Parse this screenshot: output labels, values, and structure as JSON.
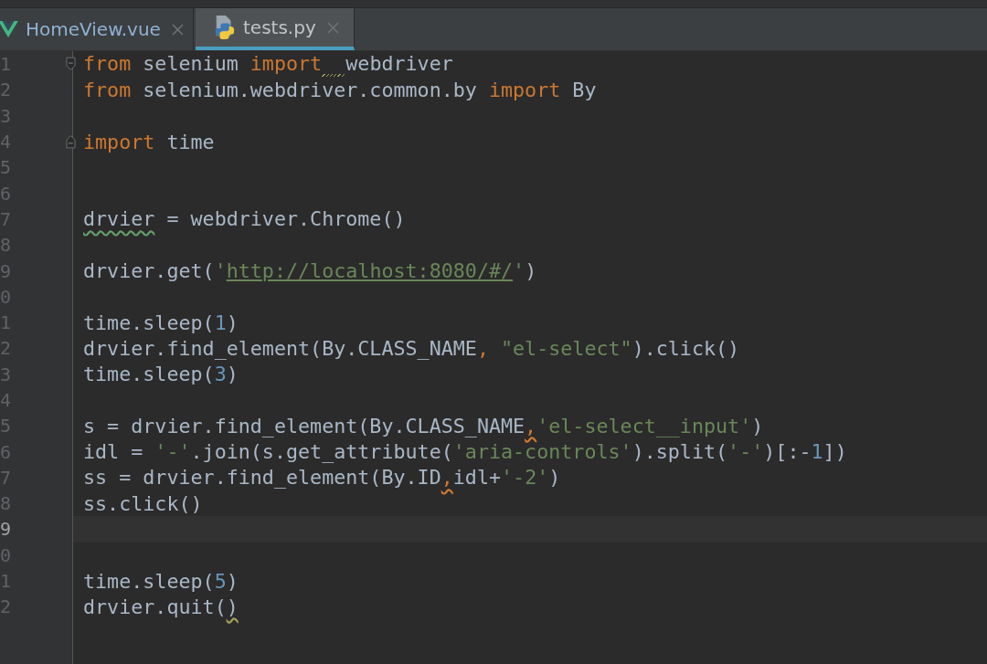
{
  "tabs": [
    {
      "label": "HomeView.vue",
      "selected": false
    },
    {
      "label": "tests.py",
      "selected": true
    }
  ],
  "editor": {
    "lines": [
      {
        "number": "1",
        "current": false,
        "fold_start": true,
        "tokens": [
          {
            "kind": "keyword",
            "text": "from"
          },
          {
            "kind": "plain",
            "text": " selenium "
          },
          {
            "kind": "keyword",
            "text": "import"
          },
          {
            "kind": "gap",
            "warning": true
          },
          {
            "kind": "plain",
            "text": "webdriver"
          }
        ]
      },
      {
        "number": "2",
        "current": false,
        "tokens": [
          {
            "kind": "keyword",
            "text": "from"
          },
          {
            "kind": "plain",
            "text": " selenium.webdriver.common.by "
          },
          {
            "kind": "keyword",
            "text": "import"
          },
          {
            "kind": "plain",
            "text": " By"
          }
        ]
      },
      {
        "number": "3",
        "current": false
      },
      {
        "number": "4",
        "current": false,
        "fold_end": true,
        "tokens": [
          {
            "kind": "keyword",
            "text": "import"
          },
          {
            "kind": "plain",
            "text": " time"
          }
        ]
      },
      {
        "number": "5",
        "current": false
      },
      {
        "number": "6",
        "current": false
      },
      {
        "number": "7",
        "current": false,
        "tokens": [
          {
            "kind": "plain",
            "text": "drvier",
            "typo": true
          },
          {
            "kind": "plain",
            "text": " = webdriver.Chrome()"
          }
        ]
      },
      {
        "number": "8",
        "current": false
      },
      {
        "number": "9",
        "current": false,
        "tokens": [
          {
            "kind": "plain",
            "text": "drvier.get("
          },
          {
            "kind": "string",
            "text": "'"
          },
          {
            "kind": "url",
            "text": "http://localhost:8080/#/"
          },
          {
            "kind": "string",
            "text": "'"
          },
          {
            "kind": "plain",
            "text": ")"
          }
        ]
      },
      {
        "number": "0",
        "current": false
      },
      {
        "number": "1",
        "current": false,
        "tokens": [
          {
            "kind": "plain",
            "text": "time.sleep("
          },
          {
            "kind": "number",
            "text": "1"
          },
          {
            "kind": "plain",
            "text": ")"
          }
        ]
      },
      {
        "number": "2",
        "current": false,
        "tokens": [
          {
            "kind": "plain",
            "text": "drvier.find_element(By.CLASS_NAME"
          },
          {
            "kind": "keyword",
            "text": ","
          },
          {
            "kind": "string",
            "text": " \"el-select\""
          },
          {
            "kind": "plain",
            "text": ").click()"
          }
        ]
      },
      {
        "number": "3",
        "current": false,
        "tokens": [
          {
            "kind": "plain",
            "text": "time.sleep("
          },
          {
            "kind": "number",
            "text": "3"
          },
          {
            "kind": "plain",
            "text": ")"
          }
        ]
      },
      {
        "number": "4",
        "current": false
      },
      {
        "number": "5",
        "current": false,
        "tokens": [
          {
            "kind": "plain",
            "text": "s = drvier.find_element(By.CLASS_NAME"
          },
          {
            "kind": "keyword",
            "text": ",",
            "warning": true
          },
          {
            "kind": "string",
            "text": "'el-select__input'"
          },
          {
            "kind": "plain",
            "text": ")"
          }
        ]
      },
      {
        "number": "6",
        "current": false,
        "tokens": [
          {
            "kind": "plain",
            "text": "idl = "
          },
          {
            "kind": "string",
            "text": "'-'"
          },
          {
            "kind": "plain",
            "text": ".join(s.get_attribute("
          },
          {
            "kind": "string",
            "text": "'aria-controls'"
          },
          {
            "kind": "plain",
            "text": ").split("
          },
          {
            "kind": "string",
            "text": "'-'"
          },
          {
            "kind": "plain",
            "text": ")[:-"
          },
          {
            "kind": "number",
            "text": "1"
          },
          {
            "kind": "plain",
            "text": "])"
          }
        ]
      },
      {
        "number": "7",
        "current": false,
        "tokens": [
          {
            "kind": "plain",
            "text": "ss = drvier.find_element(By.ID"
          },
          {
            "kind": "keyword",
            "text": ",",
            "warning": true
          },
          {
            "kind": "plain",
            "text": "idl+"
          },
          {
            "kind": "string",
            "text": "'-2'"
          },
          {
            "kind": "plain",
            "text": ")"
          }
        ]
      },
      {
        "number": "8",
        "current": false,
        "tokens": [
          {
            "kind": "plain",
            "text": "ss.click()"
          }
        ]
      },
      {
        "number": "9",
        "current": true
      },
      {
        "number": "0",
        "current": false
      },
      {
        "number": "1",
        "current": false,
        "tokens": [
          {
            "kind": "plain",
            "text": "time.sleep("
          },
          {
            "kind": "number",
            "text": "5"
          },
          {
            "kind": "plain",
            "text": ")"
          }
        ]
      },
      {
        "number": "2",
        "current": false,
        "tokens": [
          {
            "kind": "plain",
            "text": "drvier.quit("
          },
          {
            "kind": "plain",
            "text": ")",
            "warning": true
          }
        ]
      }
    ]
  }
}
